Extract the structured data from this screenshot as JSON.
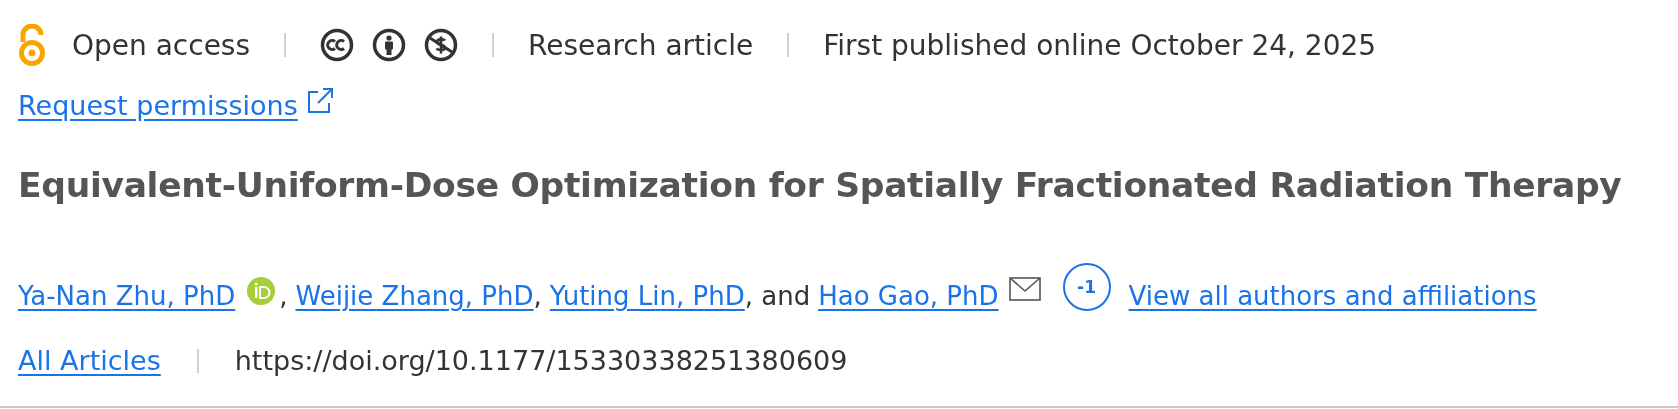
{
  "meta_bar": {
    "access": "Open access",
    "licence_icons": [
      {
        "kind": "cc"
      },
      {
        "kind": "by"
      },
      {
        "kind": "nc"
      }
    ],
    "article_type": "Research article",
    "published": "First published online October 24, 2025"
  },
  "permissions_link": "Request permissions",
  "title": "Equivalent-Uniform-Dose Optimization for Spatially Fractionated Radiation Therapy",
  "authors": [
    {
      "name": "Ya-Nan Zhu, PhD",
      "orcid": true,
      "email": false,
      "joiner": ","
    },
    {
      "name": "Weijie Zhang, PhD",
      "orcid": false,
      "email": false,
      "joiner": ","
    },
    {
      "name": "Yuting Lin, PhD",
      "orcid": false,
      "email": false,
      "joiner": ", and"
    },
    {
      "name": "Hao Gao, PhD",
      "orcid": false,
      "email": true
    }
  ],
  "authors_badge": "-1",
  "view_all_link": "View all authors and affiliations",
  "collection_link": "All Articles",
  "doi": "https://doi.org/10.1177/15330338251380609"
}
